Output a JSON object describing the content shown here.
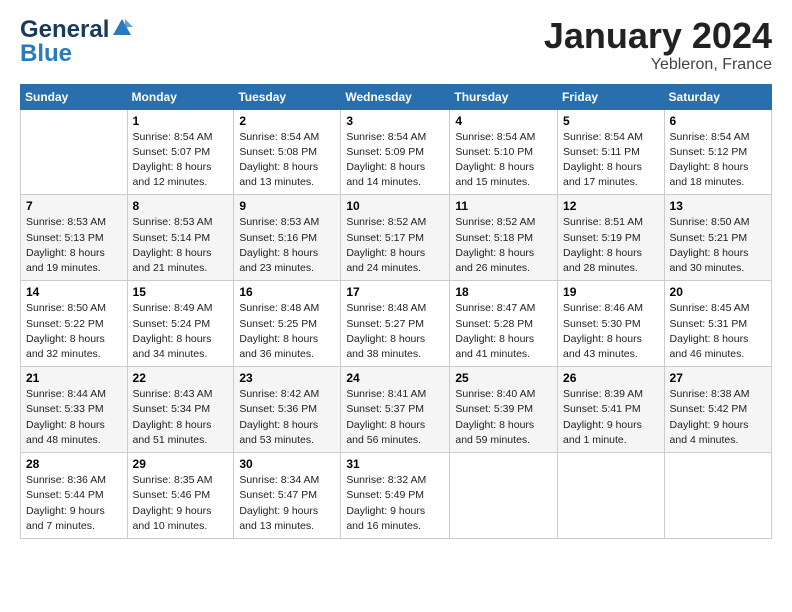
{
  "logo": {
    "line1": "General",
    "line2": "Blue"
  },
  "header": {
    "month_year": "January 2024",
    "location": "Yebleron, France"
  },
  "days_of_week": [
    "Sunday",
    "Monday",
    "Tuesday",
    "Wednesday",
    "Thursday",
    "Friday",
    "Saturday"
  ],
  "weeks": [
    [
      {
        "num": "",
        "info": ""
      },
      {
        "num": "1",
        "info": "Sunrise: 8:54 AM\nSunset: 5:07 PM\nDaylight: 8 hours\nand 12 minutes."
      },
      {
        "num": "2",
        "info": "Sunrise: 8:54 AM\nSunset: 5:08 PM\nDaylight: 8 hours\nand 13 minutes."
      },
      {
        "num": "3",
        "info": "Sunrise: 8:54 AM\nSunset: 5:09 PM\nDaylight: 8 hours\nand 14 minutes."
      },
      {
        "num": "4",
        "info": "Sunrise: 8:54 AM\nSunset: 5:10 PM\nDaylight: 8 hours\nand 15 minutes."
      },
      {
        "num": "5",
        "info": "Sunrise: 8:54 AM\nSunset: 5:11 PM\nDaylight: 8 hours\nand 17 minutes."
      },
      {
        "num": "6",
        "info": "Sunrise: 8:54 AM\nSunset: 5:12 PM\nDaylight: 8 hours\nand 18 minutes."
      }
    ],
    [
      {
        "num": "7",
        "info": "Sunrise: 8:53 AM\nSunset: 5:13 PM\nDaylight: 8 hours\nand 19 minutes."
      },
      {
        "num": "8",
        "info": "Sunrise: 8:53 AM\nSunset: 5:14 PM\nDaylight: 8 hours\nand 21 minutes."
      },
      {
        "num": "9",
        "info": "Sunrise: 8:53 AM\nSunset: 5:16 PM\nDaylight: 8 hours\nand 23 minutes."
      },
      {
        "num": "10",
        "info": "Sunrise: 8:52 AM\nSunset: 5:17 PM\nDaylight: 8 hours\nand 24 minutes."
      },
      {
        "num": "11",
        "info": "Sunrise: 8:52 AM\nSunset: 5:18 PM\nDaylight: 8 hours\nand 26 minutes."
      },
      {
        "num": "12",
        "info": "Sunrise: 8:51 AM\nSunset: 5:19 PM\nDaylight: 8 hours\nand 28 minutes."
      },
      {
        "num": "13",
        "info": "Sunrise: 8:50 AM\nSunset: 5:21 PM\nDaylight: 8 hours\nand 30 minutes."
      }
    ],
    [
      {
        "num": "14",
        "info": "Sunrise: 8:50 AM\nSunset: 5:22 PM\nDaylight: 8 hours\nand 32 minutes."
      },
      {
        "num": "15",
        "info": "Sunrise: 8:49 AM\nSunset: 5:24 PM\nDaylight: 8 hours\nand 34 minutes."
      },
      {
        "num": "16",
        "info": "Sunrise: 8:48 AM\nSunset: 5:25 PM\nDaylight: 8 hours\nand 36 minutes."
      },
      {
        "num": "17",
        "info": "Sunrise: 8:48 AM\nSunset: 5:27 PM\nDaylight: 8 hours\nand 38 minutes."
      },
      {
        "num": "18",
        "info": "Sunrise: 8:47 AM\nSunset: 5:28 PM\nDaylight: 8 hours\nand 41 minutes."
      },
      {
        "num": "19",
        "info": "Sunrise: 8:46 AM\nSunset: 5:30 PM\nDaylight: 8 hours\nand 43 minutes."
      },
      {
        "num": "20",
        "info": "Sunrise: 8:45 AM\nSunset: 5:31 PM\nDaylight: 8 hours\nand 46 minutes."
      }
    ],
    [
      {
        "num": "21",
        "info": "Sunrise: 8:44 AM\nSunset: 5:33 PM\nDaylight: 8 hours\nand 48 minutes."
      },
      {
        "num": "22",
        "info": "Sunrise: 8:43 AM\nSunset: 5:34 PM\nDaylight: 8 hours\nand 51 minutes."
      },
      {
        "num": "23",
        "info": "Sunrise: 8:42 AM\nSunset: 5:36 PM\nDaylight: 8 hours\nand 53 minutes."
      },
      {
        "num": "24",
        "info": "Sunrise: 8:41 AM\nSunset: 5:37 PM\nDaylight: 8 hours\nand 56 minutes."
      },
      {
        "num": "25",
        "info": "Sunrise: 8:40 AM\nSunset: 5:39 PM\nDaylight: 8 hours\nand 59 minutes."
      },
      {
        "num": "26",
        "info": "Sunrise: 8:39 AM\nSunset: 5:41 PM\nDaylight: 9 hours\nand 1 minute."
      },
      {
        "num": "27",
        "info": "Sunrise: 8:38 AM\nSunset: 5:42 PM\nDaylight: 9 hours\nand 4 minutes."
      }
    ],
    [
      {
        "num": "28",
        "info": "Sunrise: 8:36 AM\nSunset: 5:44 PM\nDaylight: 9 hours\nand 7 minutes."
      },
      {
        "num": "29",
        "info": "Sunrise: 8:35 AM\nSunset: 5:46 PM\nDaylight: 9 hours\nand 10 minutes."
      },
      {
        "num": "30",
        "info": "Sunrise: 8:34 AM\nSunset: 5:47 PM\nDaylight: 9 hours\nand 13 minutes."
      },
      {
        "num": "31",
        "info": "Sunrise: 8:32 AM\nSunset: 5:49 PM\nDaylight: 9 hours\nand 16 minutes."
      },
      {
        "num": "",
        "info": ""
      },
      {
        "num": "",
        "info": ""
      },
      {
        "num": "",
        "info": ""
      }
    ]
  ]
}
